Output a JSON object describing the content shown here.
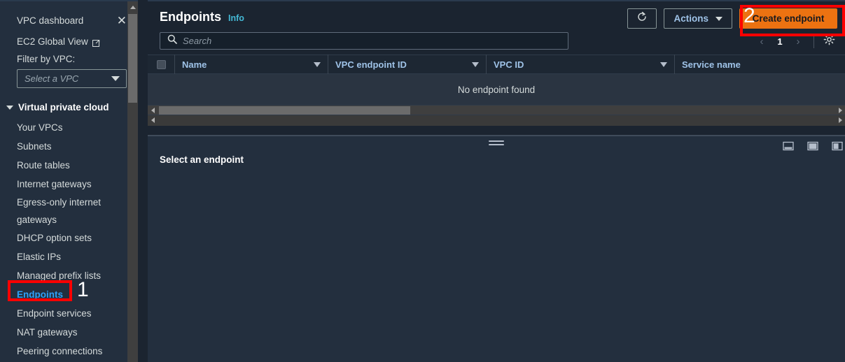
{
  "sidebar": {
    "dashboard": {
      "label": "VPC dashboard",
      "close_icon": "close-icon"
    },
    "global_view": {
      "label": "EC2 Global View",
      "icon": "external-link-icon"
    },
    "filter_label": "Filter by VPC:",
    "vpc_select": {
      "placeholder": "Select a VPC",
      "icon": "chevron-down-icon"
    },
    "group": {
      "label": "Virtual private cloud",
      "icon": "triangle-down-icon"
    },
    "items": [
      {
        "label": "Your VPCs",
        "active": false
      },
      {
        "label": "Subnets",
        "active": false
      },
      {
        "label": "Route tables",
        "active": false
      },
      {
        "label": "Internet gateways",
        "active": false
      },
      {
        "label": "Egress-only internet gateways",
        "active": false
      },
      {
        "label": "DHCP option sets",
        "active": false
      },
      {
        "label": "Elastic IPs",
        "active": false
      },
      {
        "label": "Managed prefix lists",
        "active": false
      },
      {
        "label": "Endpoints",
        "active": true
      },
      {
        "label": "Endpoint services",
        "active": false
      },
      {
        "label": "NAT gateways",
        "active": false
      },
      {
        "label": "Peering connections",
        "active": false
      }
    ]
  },
  "header": {
    "title": "Endpoints",
    "info_label": "Info",
    "refresh_icon": "refresh-icon",
    "actions_label": "Actions",
    "actions_icon": "chevron-down-icon",
    "create_label": "Create endpoint"
  },
  "search": {
    "placeholder": "Search",
    "icon": "search-icon"
  },
  "pagination": {
    "prev_icon": "chevron-left-icon",
    "page": "1",
    "next_icon": "chevron-right-icon",
    "settings_icon": "gear-icon"
  },
  "table": {
    "select_all_icon": "checkbox-indeterminate",
    "columns": [
      {
        "label": "Name",
        "sortable": true
      },
      {
        "label": "VPC endpoint ID",
        "sortable": true
      },
      {
        "label": "VPC ID",
        "sortable": true
      },
      {
        "label": "Service name",
        "sortable": false
      }
    ],
    "rows": [],
    "empty_message": "No endpoint found"
  },
  "split_panel": {
    "title": "Select an endpoint",
    "drag_handle": "drag-handle",
    "layout_icons": [
      "panel-bottom-icon",
      "panel-side-icon",
      "panel-right-icon"
    ]
  },
  "annotations": [
    {
      "id": "1",
      "number": "1",
      "target": "sidebar-item-endpoints",
      "color": "#ff0000"
    },
    {
      "id": "2",
      "number": "2",
      "target": "create-endpoint-button",
      "color": "#ff0000"
    }
  ],
  "colors": {
    "accent_orange": "#ec7211",
    "link_blue": "#2ea1f8",
    "annotation_red": "#ff0000",
    "background": "#232f3e"
  }
}
